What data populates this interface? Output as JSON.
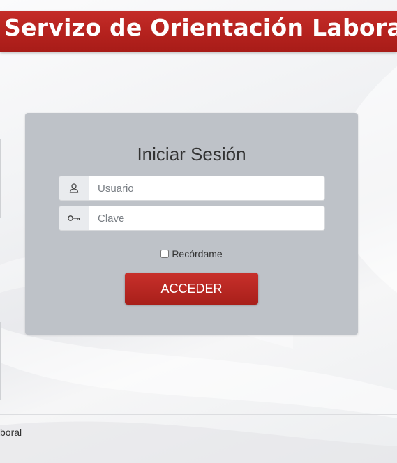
{
  "header": {
    "title": "Servizo de Orientación Laboral",
    "background_color": "#b3211d"
  },
  "login": {
    "title": "Iniciar Sesión",
    "username_placeholder": "Usuario",
    "username_value": "",
    "username_icon": "user-icon",
    "password_placeholder": "Clave",
    "password_value": "",
    "password_icon": "key-icon",
    "remember_label": "Recórdame",
    "remember_checked": false,
    "submit_label": "ACCEDER",
    "panel_color": "#bec2c8",
    "button_color": "#b3211d"
  },
  "footer": {
    "text": "boral"
  }
}
